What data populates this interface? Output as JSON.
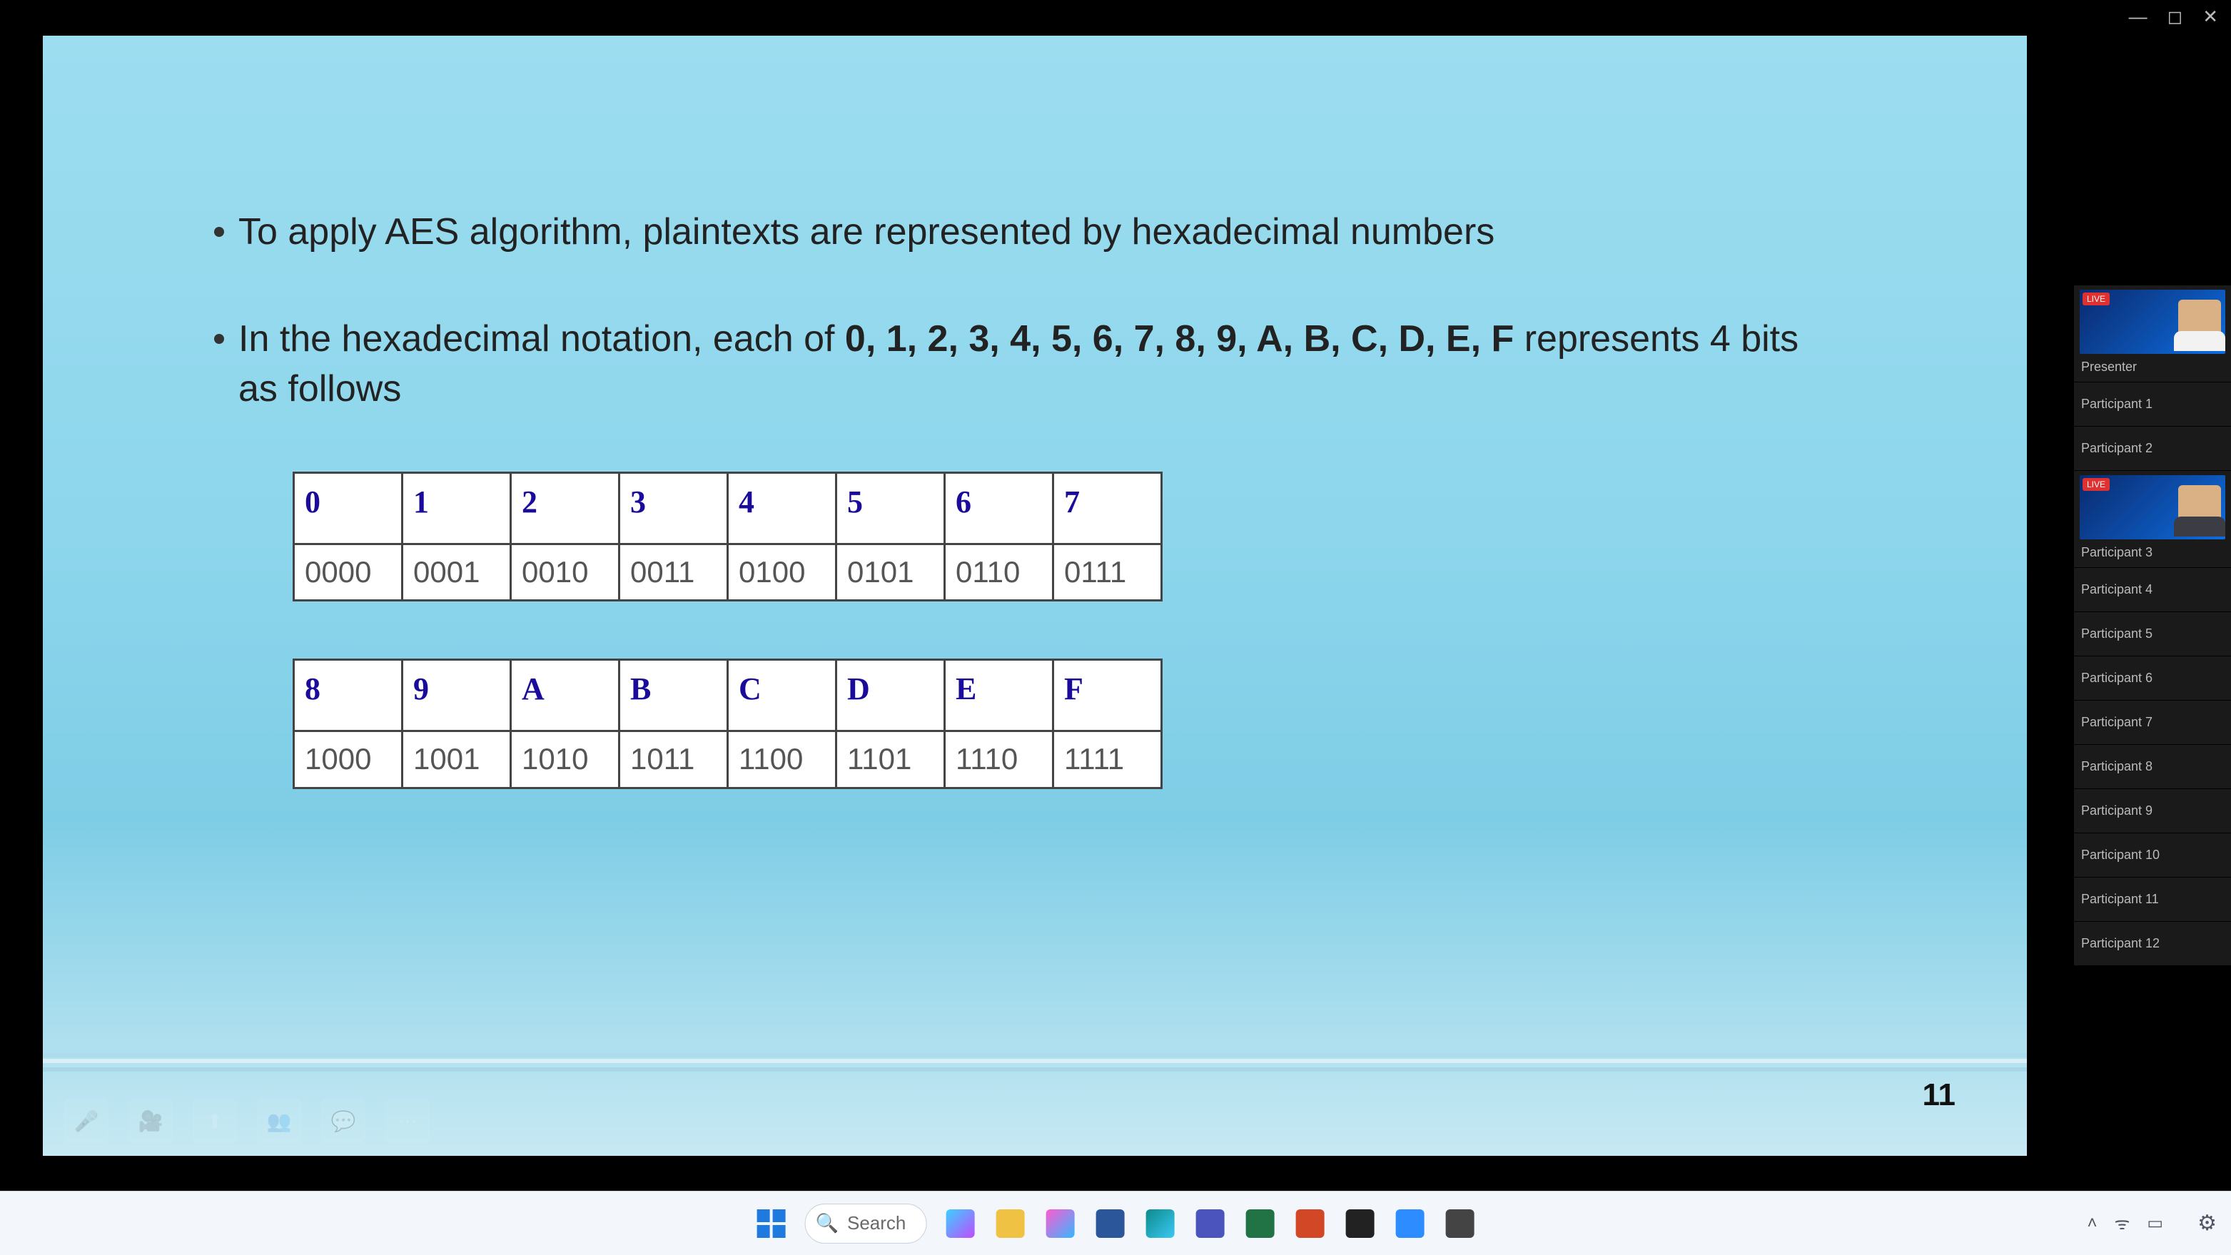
{
  "window_controls": {
    "min": "—",
    "max": "◻",
    "close": "✕"
  },
  "slide": {
    "bullet1_pre": "To apply AES algorithm, plaintexts are represented by hexadecimal numbers",
    "bullet2_pre": "In the hexadecimal notation, each of ",
    "bullet2_bold": "0, 1, 2, 3, 4, 5, 6, 7, 8, 9, A, B, C, D, E, F",
    "bullet2_post": " represents 4 bits as follows",
    "table1_head": [
      "0",
      "1",
      "2",
      "3",
      "4",
      "5",
      "6",
      "7"
    ],
    "table1_body": [
      "0000",
      "0001",
      "0010",
      "0011",
      "0100",
      "0101",
      "0110",
      "0111"
    ],
    "table2_head": [
      "8",
      "9",
      "A",
      "B",
      "C",
      "D",
      "E",
      "F"
    ],
    "table2_body": [
      "1000",
      "1001",
      "1010",
      "1011",
      "1100",
      "1101",
      "1110",
      "1111"
    ],
    "page_num": "11"
  },
  "participants": [
    {
      "name": "Presenter",
      "has_video": true,
      "shirt": "white",
      "badge": "LIVE"
    },
    {
      "name": "Participant 1",
      "has_video": false
    },
    {
      "name": "Participant 2",
      "has_video": false
    },
    {
      "name": "Participant 3",
      "has_video": true,
      "shirt": "dark",
      "badge": "LIVE"
    },
    {
      "name": "Participant 4",
      "has_video": false
    },
    {
      "name": "Participant 5",
      "has_video": false
    },
    {
      "name": "Participant 6",
      "has_video": false
    },
    {
      "name": "Participant 7",
      "has_video": false
    },
    {
      "name": "Participant 8",
      "has_video": false
    },
    {
      "name": "Participant 9",
      "has_video": false
    },
    {
      "name": "Participant 10",
      "has_video": false
    },
    {
      "name": "Participant 11",
      "has_video": false
    },
    {
      "name": "Participant 12",
      "has_video": false
    }
  ],
  "taskbar": {
    "search_placeholder": "Search",
    "apps": [
      {
        "semantic": "copilot-icon",
        "color": "linear-gradient(135deg,#3bd1ff,#c04bff)"
      },
      {
        "semantic": "file-explorer-icon",
        "color": "#f0c244"
      },
      {
        "semantic": "widgets-icon",
        "color": "linear-gradient(135deg,#ff5bd1,#36b6ff)"
      },
      {
        "semantic": "word-icon",
        "color": "#2b579a"
      },
      {
        "semantic": "edge-icon",
        "color": "linear-gradient(135deg,#0b8b8b,#3cc8f4)"
      },
      {
        "semantic": "teams-icon",
        "color": "#4b53bc"
      },
      {
        "semantic": "excel-icon",
        "color": "#217346"
      },
      {
        "semantic": "powerpoint-icon",
        "color": "#d24726"
      },
      {
        "semantic": "app-dark-icon",
        "color": "#222"
      },
      {
        "semantic": "zoom-icon",
        "color": "#2d8cff"
      },
      {
        "semantic": "settings-app-icon",
        "color": "#444"
      }
    ],
    "tray": {
      "chevron": "˄",
      "wifi": "ᯤ",
      "battery": "▭",
      "time": "",
      "date": "",
      "gear": "⚙"
    }
  }
}
